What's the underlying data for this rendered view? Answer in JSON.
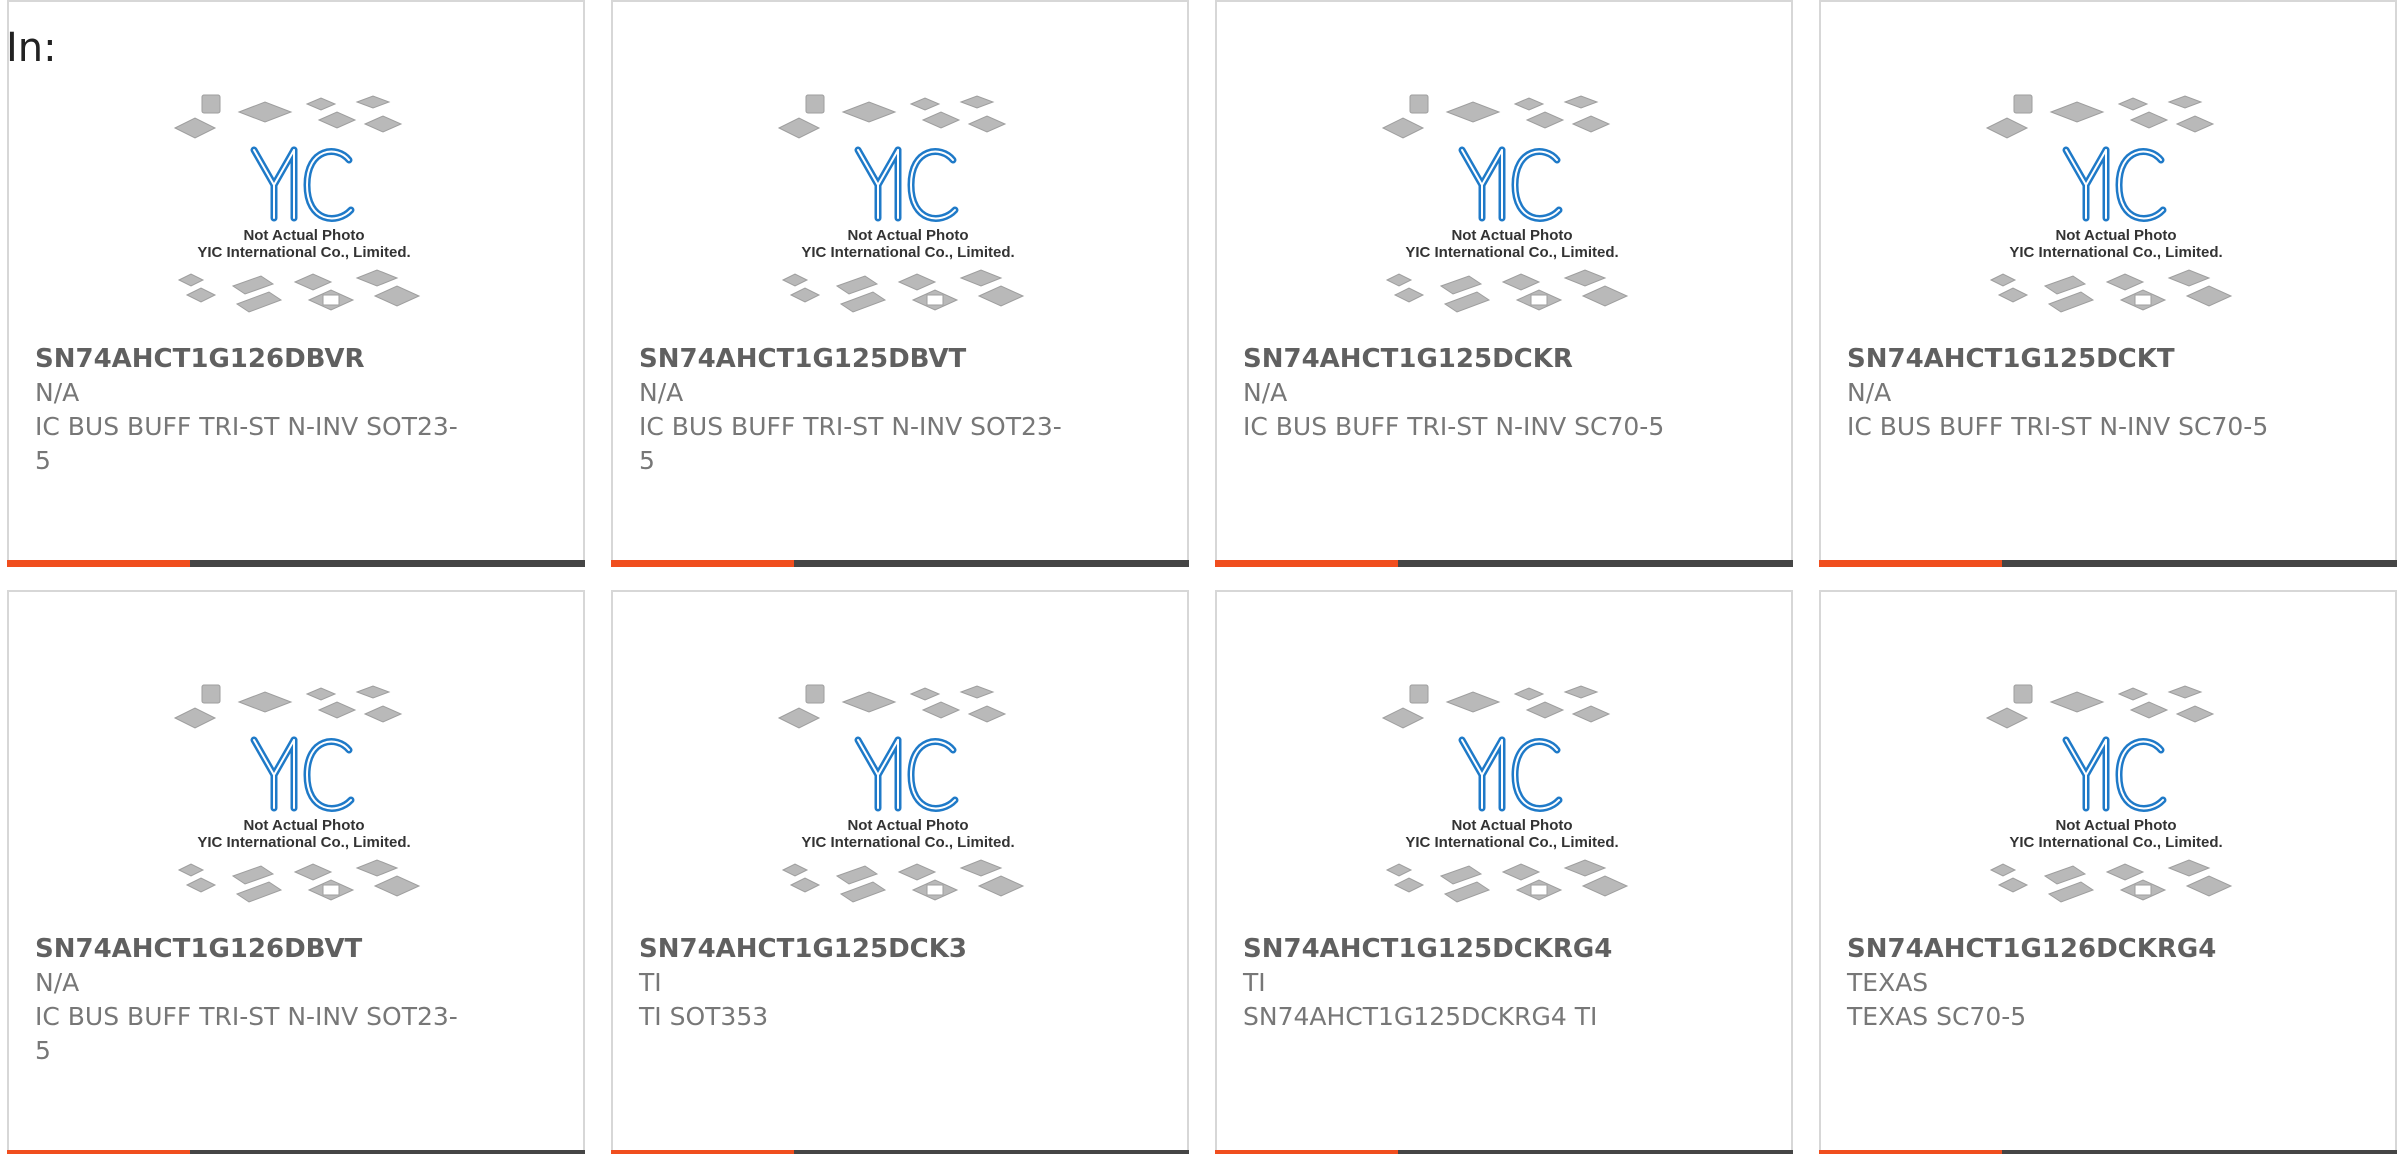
{
  "page": {
    "title": "In:"
  },
  "theme": {
    "accent": "#f04e1e",
    "bar": "#454545",
    "logo_blue": "#1f7ac8"
  },
  "placeholder_photo": {
    "icon": "chip-packages-placeholder-icon",
    "line1": "Not Actual Photo",
    "line2": "YIC International Co., Limited.",
    "logo_text": "YIC"
  },
  "products": [
    {
      "part": "SN74AHCT1G126DBVR",
      "brand": "N/A",
      "desc": "IC BUS BUFF TRI-ST N-INV SOT23-5"
    },
    {
      "part": "SN74AHCT1G125DBVT",
      "brand": "N/A",
      "desc": "IC BUS BUFF TRI-ST N-INV SOT23-5"
    },
    {
      "part": "SN74AHCT1G125DCKR",
      "brand": "N/A",
      "desc": "IC BUS BUFF TRI-ST N-INV SC70-5"
    },
    {
      "part": "SN74AHCT1G125DCKT",
      "brand": "N/A",
      "desc": "IC BUS BUFF TRI-ST N-INV SC70-5"
    },
    {
      "part": "SN74AHCT1G126DBVT",
      "brand": "N/A",
      "desc": "IC BUS BUFF TRI-ST N-INV SOT23-5"
    },
    {
      "part": "SN74AHCT1G125DCK3",
      "brand": "TI",
      "desc": "TI SOT353"
    },
    {
      "part": "SN74AHCT1G125DCKRG4",
      "brand": "TI",
      "desc": "SN74AHCT1G125DCKRG4 TI"
    },
    {
      "part": "SN74AHCT1G126DCKRG4",
      "brand": "TEXAS",
      "desc": "TEXAS SC70-5"
    }
  ]
}
